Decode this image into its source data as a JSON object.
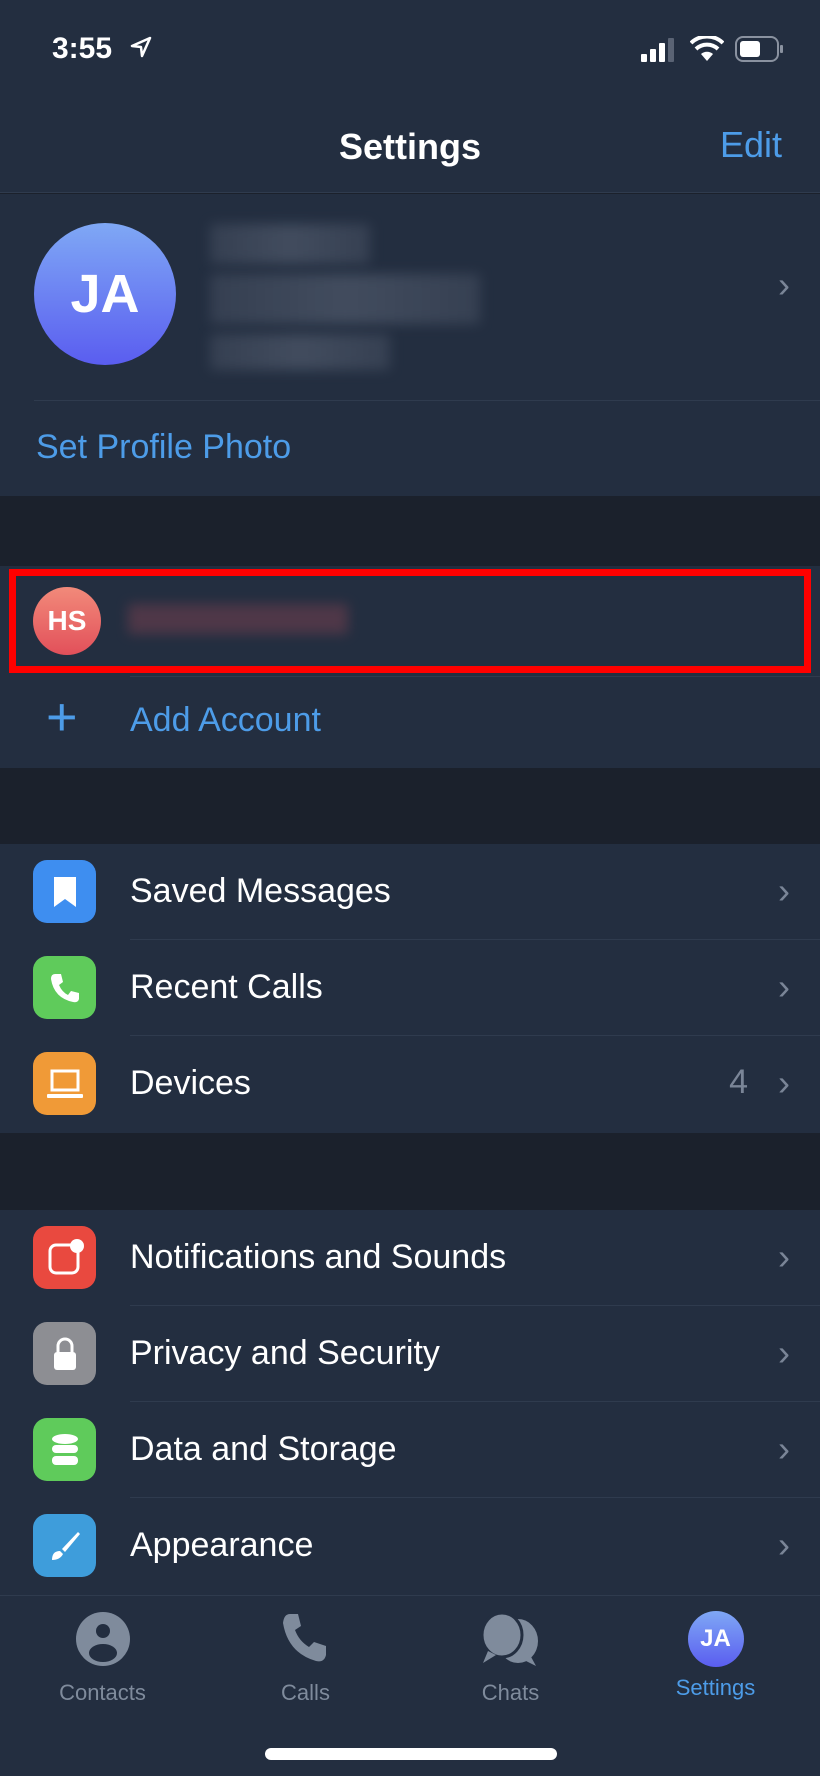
{
  "status_bar": {
    "time": "3:55",
    "icons": [
      "location-arrow-icon",
      "signal-icon",
      "wifi-icon",
      "battery-icon"
    ]
  },
  "nav": {
    "title": "Settings",
    "edit_label": "Edit"
  },
  "profile": {
    "initials": "JA",
    "set_photo_label": "Set Profile Photo"
  },
  "accounts": {
    "other_initials": "HS",
    "add_label": "Add Account",
    "highlight_color": "#ff0000"
  },
  "group1": [
    {
      "label": "Saved Messages",
      "icon": "bookmark-icon",
      "color": "#3e8ef0"
    },
    {
      "label": "Recent Calls",
      "icon": "phone-icon",
      "color": "#5fcb5b"
    },
    {
      "label": "Devices",
      "icon": "laptop-icon",
      "color": "#f09a37",
      "value": "4"
    }
  ],
  "group2": [
    {
      "label": "Notifications and Sounds",
      "icon": "notification-icon",
      "color": "#e9493f"
    },
    {
      "label": "Privacy and Security",
      "icon": "lock-icon",
      "color": "#8d8e93"
    },
    {
      "label": "Data and Storage",
      "icon": "database-icon",
      "color": "#5fcb5b"
    },
    {
      "label": "Appearance",
      "icon": "brush-icon",
      "color": "#3e9ddb"
    }
  ],
  "tabs": [
    {
      "label": "Contacts",
      "icon": "person-circle-icon"
    },
    {
      "label": "Calls",
      "icon": "phone-icon"
    },
    {
      "label": "Chats",
      "icon": "chat-bubbles-icon"
    },
    {
      "label": "Settings",
      "icon": "avatar-JA",
      "active": true
    }
  ],
  "colors": {
    "accent": "#4d9ce8",
    "background": "#232e40",
    "gap": "#1b212c"
  }
}
